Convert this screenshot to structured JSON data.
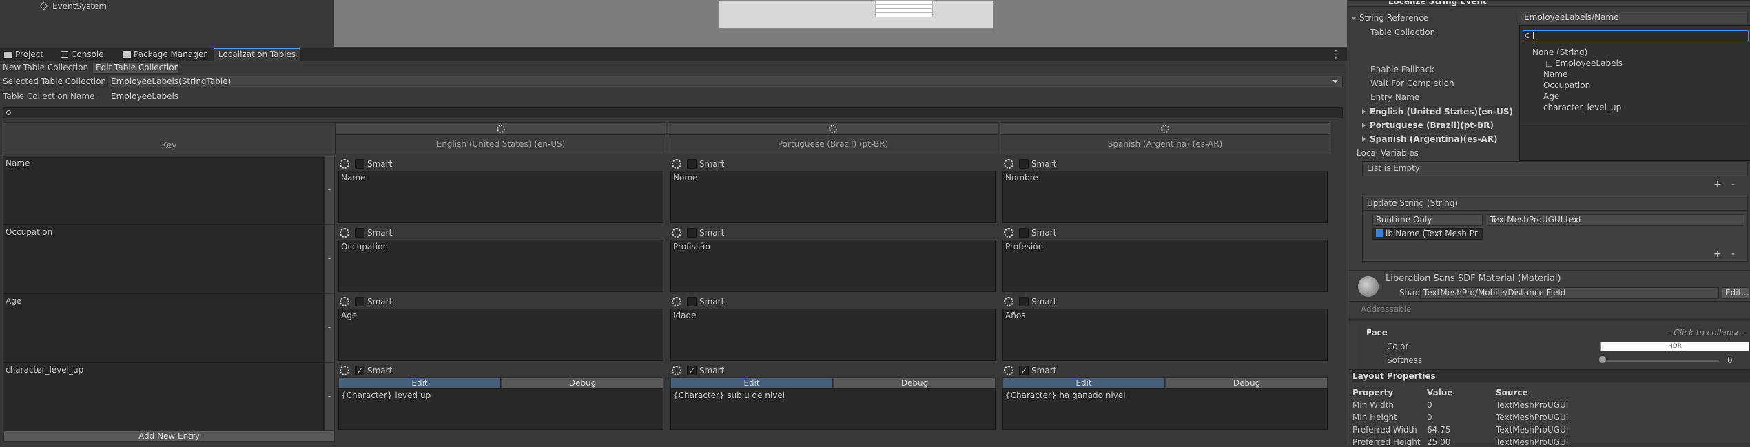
{
  "hierarchy": {
    "item": "EventSystem"
  },
  "tabs": [
    {
      "label": "Project",
      "icon": "folder-icon"
    },
    {
      "label": "Console",
      "icon": "console-icon"
    },
    {
      "label": "Package Manager",
      "icon": "package-icon"
    },
    {
      "label": "Localization Tables",
      "icon": ""
    }
  ],
  "toolbar": {
    "new_collection": "New Table Collection",
    "edit_collection": "Edit Table Collection"
  },
  "selected": {
    "label": "Selected Table Collection",
    "value": "EmployeeLabels(StringTable)"
  },
  "collection_name": {
    "label": "Table Collection Name",
    "value": "EmployeeLabels"
  },
  "table": {
    "key_header": "Key",
    "locales": [
      "English (United States) (en-US)",
      "Portuguese (Brazil) (pt-BR)",
      "Spanish (Argentina) (es-AR)"
    ],
    "smart_label": "Smart",
    "edit_label": "Edit",
    "debug_label": "Debug",
    "rows": [
      {
        "key": "Name",
        "smart": false,
        "values": [
          "Name",
          "Nome",
          "Nombre"
        ]
      },
      {
        "key": "Occupation",
        "smart": false,
        "values": [
          "Occupation",
          "Profissão",
          "Profesión"
        ]
      },
      {
        "key": "Age",
        "smart": false,
        "values": [
          "Age",
          "Idade",
          "Años"
        ]
      },
      {
        "key": "character_level_up",
        "smart": true,
        "values": [
          "{Character} leved up",
          "{Character} subiu de nivel",
          "{Character} ha ganado nivel"
        ]
      }
    ],
    "add_entry": "Add New Entry",
    "remove_glyph": "-"
  },
  "inspector": {
    "component_title": "Localize String Event",
    "string_reference": {
      "label": "String Reference",
      "value": "EmployeeLabels/Name"
    },
    "table_collection": "Table Collection",
    "enable_fallback": "Enable Fallback",
    "wait_for_completion": "Wait For Completion",
    "entry_name": "Entry Name",
    "locales": [
      "English (United States)(en-US)",
      "Portuguese (Brazil)(pt-BR)",
      "Spanish (Argentina)(es-AR)"
    ],
    "local_variables": "Local Variables",
    "list_empty": "List is Empty",
    "update_string": "Update String (String)",
    "runtime": "Runtime Only",
    "target": "TextMeshProUGUI.text",
    "object_ref": "lblName (Text Mesh Pr",
    "material_title": "Liberation Sans SDF Material (Material)",
    "shader_label": "Shader",
    "shader_value": "TextMeshPro/Mobile/Distance Field",
    "shader_edit": "Edit...",
    "addressable": "Addressable",
    "face": "Face",
    "click_collapse": "- Click to collapse -",
    "color": "Color",
    "hdr": "HDR",
    "softness": "Softness",
    "softness_value": "0",
    "layout_title": "Layout Properties",
    "layout_headers": [
      "Property",
      "Value",
      "Source"
    ],
    "layout_rows": [
      {
        "property": "Min Width",
        "value": "0",
        "source": "TextMeshProUGUI"
      },
      {
        "property": "Min Height",
        "value": "0",
        "source": "TextMeshProUGUI"
      },
      {
        "property": "Preferred Width",
        "value": "64.75",
        "source": "TextMeshProUGUI"
      },
      {
        "property": "Preferred Height",
        "value": "25.00",
        "source": "TextMeshProUGUI"
      }
    ],
    "plus": "+",
    "minus": "-"
  },
  "popup": {
    "items": [
      {
        "label": "None (String)",
        "indent": 0
      },
      {
        "label": "EmployeeLabels",
        "indent": 1
      },
      {
        "label": "Name",
        "indent": 2
      },
      {
        "label": "Occupation",
        "indent": 2
      },
      {
        "label": "Age",
        "indent": 2
      },
      {
        "label": "character_level_up",
        "indent": 2
      }
    ]
  }
}
